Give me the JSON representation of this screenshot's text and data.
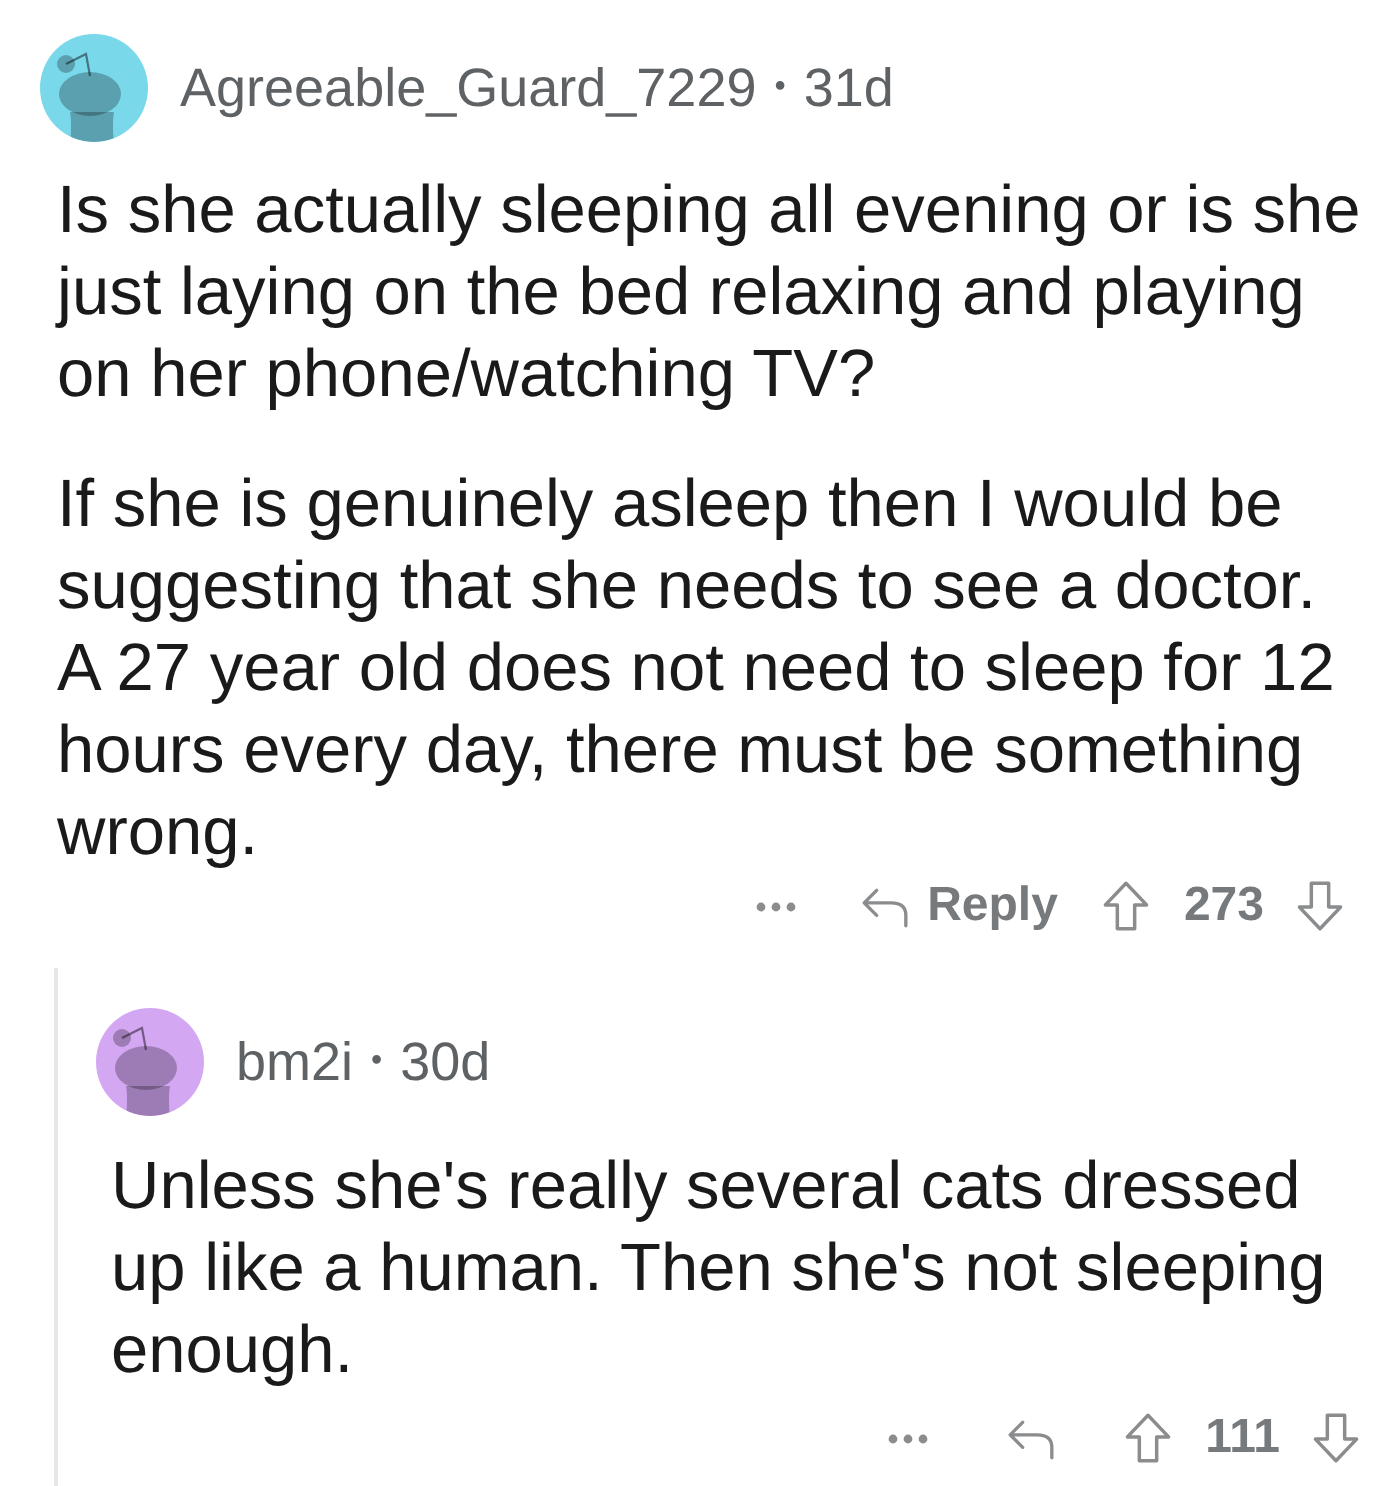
{
  "comments": [
    {
      "author": "Agreeable_Guard_7229",
      "separator": "•",
      "age": "31d",
      "color": "#7ad8eb",
      "paragraphs": [
        "Is she actually sleeping all evening or is she just laying on the bed relaxing and playing on her phone/watching TV?",
        "If she is genuinely asleep then I would be suggesting that she needs to see a doctor. A 27 year old does not need to sleep for 12 hours every day, there must be something wrong."
      ],
      "actions": {
        "reply_label": "Reply",
        "score": "273"
      },
      "children": [
        {
          "author": "bm2i",
          "separator": "•",
          "age": "30d",
          "color": "#d4a7f3",
          "paragraphs": [
            "Unless she's really several cats dressed up like a human. Then she's not sleeping enough."
          ],
          "actions": {
            "score": "111"
          }
        }
      ]
    }
  ]
}
